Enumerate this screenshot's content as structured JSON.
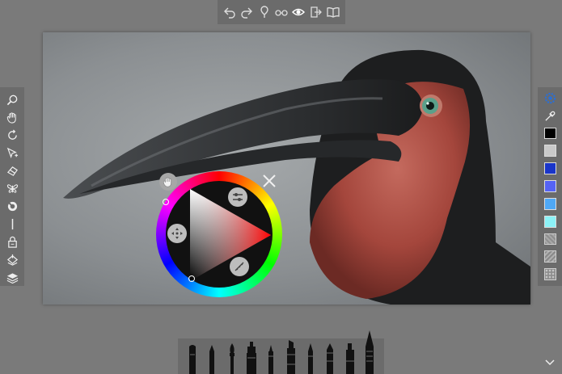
{
  "toolbar_top": {
    "buttons": [
      "undo",
      "redo",
      "pin",
      "glasses",
      "eye",
      "export",
      "book"
    ]
  },
  "toolbar_left": {
    "tools": [
      "zoom",
      "pan",
      "rotate",
      "select",
      "smudge",
      "symmetry",
      "stencil",
      "ruler",
      "lock",
      "fill",
      "layers"
    ]
  },
  "toolbar_right": {
    "settings_icon": "settings-icon",
    "eyedropper_icon": "eyedropper-icon",
    "swatches": [
      "#000000",
      "#c9c9c9",
      "#1a35c9",
      "#5563f5",
      "#4fa8f5",
      "#8cf2f7"
    ],
    "textures": [
      "texture-1",
      "texture-2",
      "texture-3"
    ]
  },
  "color_wheel": {
    "selected_hue": "#ff0000",
    "close_icon": "close-icon"
  },
  "brush_bar": {
    "brushes": [
      "pencil",
      "pen",
      "paintbrush",
      "marker",
      "technical-pen",
      "highlighter",
      "fine-pen",
      "fountain-pen",
      "chisel-marker",
      "airbrush"
    ]
  },
  "accent": "#2b6fd6"
}
